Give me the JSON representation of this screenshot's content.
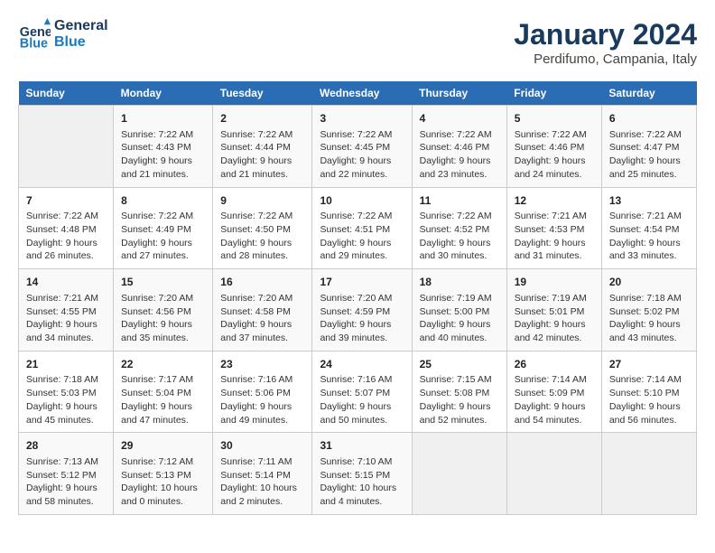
{
  "header": {
    "logo_line1": "General",
    "logo_line2": "Blue",
    "title": "January 2024",
    "subtitle": "Perdifumo, Campania, Italy"
  },
  "columns": [
    "Sunday",
    "Monday",
    "Tuesday",
    "Wednesday",
    "Thursday",
    "Friday",
    "Saturday"
  ],
  "weeks": [
    [
      {
        "day": "",
        "info": ""
      },
      {
        "day": "1",
        "info": "Sunrise: 7:22 AM\nSunset: 4:43 PM\nDaylight: 9 hours\nand 21 minutes."
      },
      {
        "day": "2",
        "info": "Sunrise: 7:22 AM\nSunset: 4:44 PM\nDaylight: 9 hours\nand 21 minutes."
      },
      {
        "day": "3",
        "info": "Sunrise: 7:22 AM\nSunset: 4:45 PM\nDaylight: 9 hours\nand 22 minutes."
      },
      {
        "day": "4",
        "info": "Sunrise: 7:22 AM\nSunset: 4:46 PM\nDaylight: 9 hours\nand 23 minutes."
      },
      {
        "day": "5",
        "info": "Sunrise: 7:22 AM\nSunset: 4:46 PM\nDaylight: 9 hours\nand 24 minutes."
      },
      {
        "day": "6",
        "info": "Sunrise: 7:22 AM\nSunset: 4:47 PM\nDaylight: 9 hours\nand 25 minutes."
      }
    ],
    [
      {
        "day": "7",
        "info": "Sunrise: 7:22 AM\nSunset: 4:48 PM\nDaylight: 9 hours\nand 26 minutes."
      },
      {
        "day": "8",
        "info": "Sunrise: 7:22 AM\nSunset: 4:49 PM\nDaylight: 9 hours\nand 27 minutes."
      },
      {
        "day": "9",
        "info": "Sunrise: 7:22 AM\nSunset: 4:50 PM\nDaylight: 9 hours\nand 28 minutes."
      },
      {
        "day": "10",
        "info": "Sunrise: 7:22 AM\nSunset: 4:51 PM\nDaylight: 9 hours\nand 29 minutes."
      },
      {
        "day": "11",
        "info": "Sunrise: 7:22 AM\nSunset: 4:52 PM\nDaylight: 9 hours\nand 30 minutes."
      },
      {
        "day": "12",
        "info": "Sunrise: 7:21 AM\nSunset: 4:53 PM\nDaylight: 9 hours\nand 31 minutes."
      },
      {
        "day": "13",
        "info": "Sunrise: 7:21 AM\nSunset: 4:54 PM\nDaylight: 9 hours\nand 33 minutes."
      }
    ],
    [
      {
        "day": "14",
        "info": "Sunrise: 7:21 AM\nSunset: 4:55 PM\nDaylight: 9 hours\nand 34 minutes."
      },
      {
        "day": "15",
        "info": "Sunrise: 7:20 AM\nSunset: 4:56 PM\nDaylight: 9 hours\nand 35 minutes."
      },
      {
        "day": "16",
        "info": "Sunrise: 7:20 AM\nSunset: 4:58 PM\nDaylight: 9 hours\nand 37 minutes."
      },
      {
        "day": "17",
        "info": "Sunrise: 7:20 AM\nSunset: 4:59 PM\nDaylight: 9 hours\nand 39 minutes."
      },
      {
        "day": "18",
        "info": "Sunrise: 7:19 AM\nSunset: 5:00 PM\nDaylight: 9 hours\nand 40 minutes."
      },
      {
        "day": "19",
        "info": "Sunrise: 7:19 AM\nSunset: 5:01 PM\nDaylight: 9 hours\nand 42 minutes."
      },
      {
        "day": "20",
        "info": "Sunrise: 7:18 AM\nSunset: 5:02 PM\nDaylight: 9 hours\nand 43 minutes."
      }
    ],
    [
      {
        "day": "21",
        "info": "Sunrise: 7:18 AM\nSunset: 5:03 PM\nDaylight: 9 hours\nand 45 minutes."
      },
      {
        "day": "22",
        "info": "Sunrise: 7:17 AM\nSunset: 5:04 PM\nDaylight: 9 hours\nand 47 minutes."
      },
      {
        "day": "23",
        "info": "Sunrise: 7:16 AM\nSunset: 5:06 PM\nDaylight: 9 hours\nand 49 minutes."
      },
      {
        "day": "24",
        "info": "Sunrise: 7:16 AM\nSunset: 5:07 PM\nDaylight: 9 hours\nand 50 minutes."
      },
      {
        "day": "25",
        "info": "Sunrise: 7:15 AM\nSunset: 5:08 PM\nDaylight: 9 hours\nand 52 minutes."
      },
      {
        "day": "26",
        "info": "Sunrise: 7:14 AM\nSunset: 5:09 PM\nDaylight: 9 hours\nand 54 minutes."
      },
      {
        "day": "27",
        "info": "Sunrise: 7:14 AM\nSunset: 5:10 PM\nDaylight: 9 hours\nand 56 minutes."
      }
    ],
    [
      {
        "day": "28",
        "info": "Sunrise: 7:13 AM\nSunset: 5:12 PM\nDaylight: 9 hours\nand 58 minutes."
      },
      {
        "day": "29",
        "info": "Sunrise: 7:12 AM\nSunset: 5:13 PM\nDaylight: 10 hours\nand 0 minutes."
      },
      {
        "day": "30",
        "info": "Sunrise: 7:11 AM\nSunset: 5:14 PM\nDaylight: 10 hours\nand 2 minutes."
      },
      {
        "day": "31",
        "info": "Sunrise: 7:10 AM\nSunset: 5:15 PM\nDaylight: 10 hours\nand 4 minutes."
      },
      {
        "day": "",
        "info": ""
      },
      {
        "day": "",
        "info": ""
      },
      {
        "day": "",
        "info": ""
      }
    ]
  ]
}
